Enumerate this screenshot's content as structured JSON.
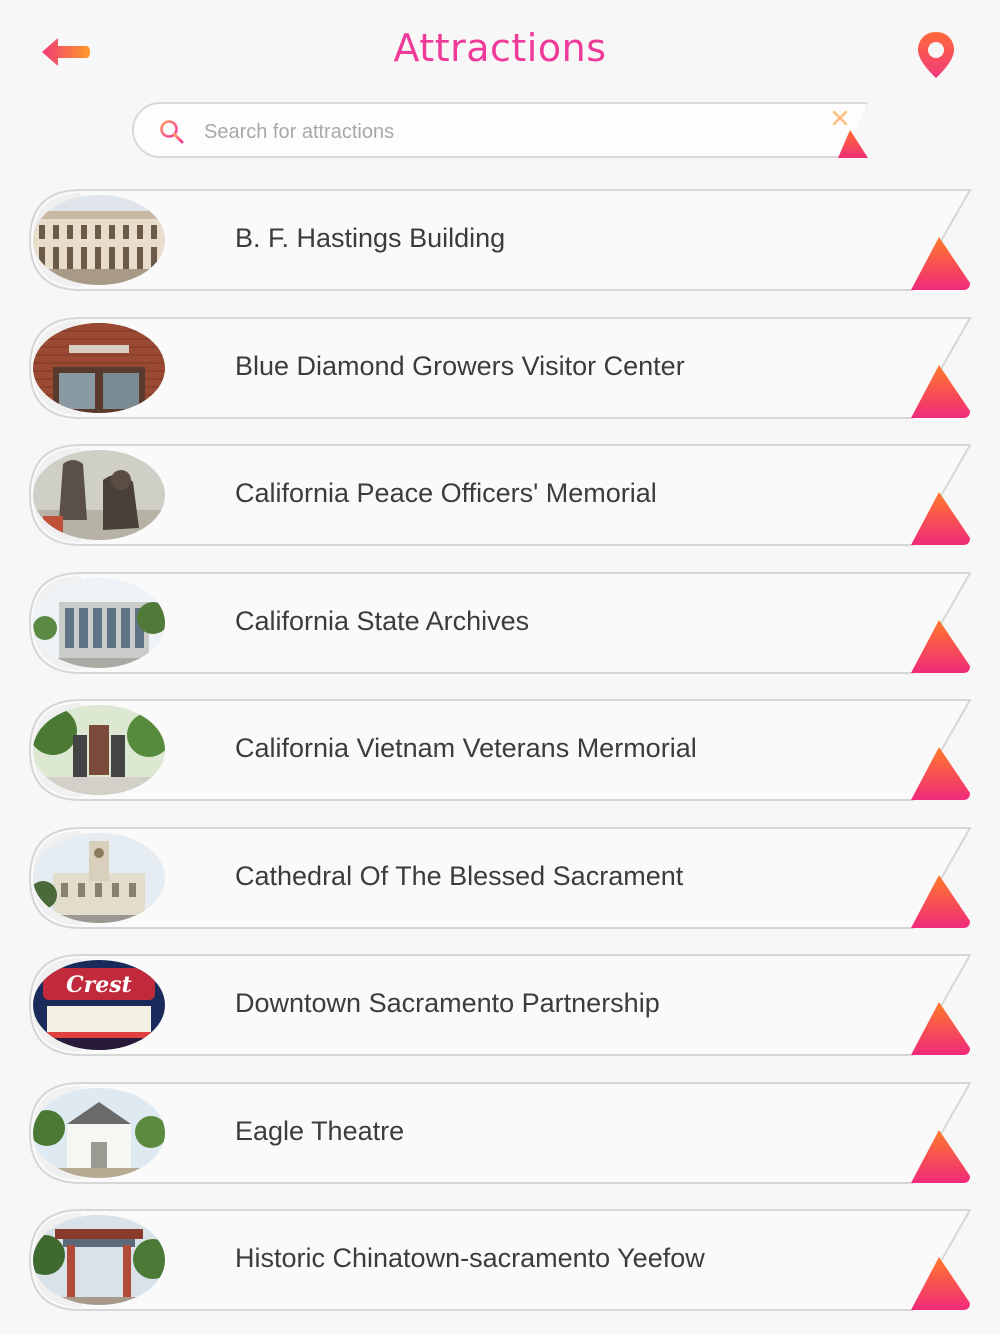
{
  "header": {
    "title": "Attractions",
    "back_icon": "arrow-left-icon",
    "map_icon": "map-pin-icon"
  },
  "search": {
    "placeholder": "Search for attractions",
    "value": "",
    "icon": "search-icon",
    "clear_icon": "close-icon"
  },
  "colors": {
    "accent_pink": "#f03a9a",
    "accent_orange": "#ff8a30",
    "row_border": "#d6d6d6",
    "text": "#3c3c3c"
  },
  "attractions": [
    {
      "name": "B. F. Hastings Building",
      "thumb": "photo-historic-building"
    },
    {
      "name": "Blue Diamond Growers Visitor Center",
      "thumb": "photo-brick-visitor-center"
    },
    {
      "name": "California Peace Officers' Memorial",
      "thumb": "photo-bronze-statues"
    },
    {
      "name": "California State Archives",
      "thumb": "photo-modern-building"
    },
    {
      "name": "California Vietnam Veterans Mermorial",
      "thumb": "photo-park-memorial"
    },
    {
      "name": "Cathedral Of The Blessed Sacrament",
      "thumb": "photo-cathedral"
    },
    {
      "name": "Downtown Sacramento Partnership",
      "thumb": "photo-crest-theatre-sign"
    },
    {
      "name": "Eagle Theatre",
      "thumb": "photo-white-theatre"
    },
    {
      "name": "Historic Chinatown-sacramento Yeefow",
      "thumb": "photo-chinatown-gate"
    }
  ]
}
